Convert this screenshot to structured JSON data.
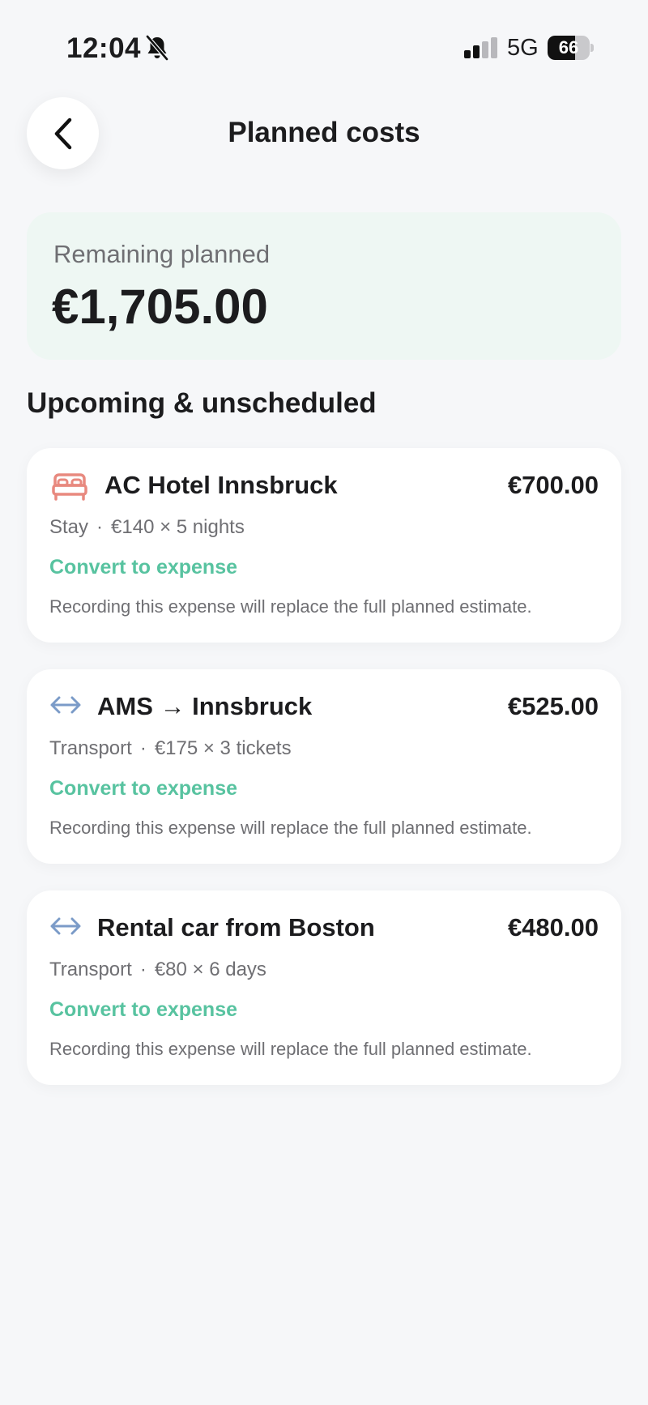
{
  "status_bar": {
    "time": "12:04",
    "network": "5G",
    "battery": "66",
    "battery_level": 0.66
  },
  "header": {
    "title": "Planned costs"
  },
  "summary": {
    "label": "Remaining planned",
    "amount": "€1,705.00",
    "background_color": "#eef7f3"
  },
  "section": {
    "title": "Upcoming & unscheduled"
  },
  "accent_color": "#58c3a0",
  "cards": [
    {
      "icon": "bed-icon",
      "icon_color": "#e8897f",
      "name": "AC Hotel Innsbruck",
      "amount": "€700.00",
      "category": "Stay",
      "detail": "€140 × 5 nights",
      "action": "Convert to expense",
      "note": "Recording this expense will replace the full planned estimate."
    },
    {
      "icon": "transport-arrows-icon",
      "icon_color": "#7b9bc8",
      "name": "AMS → Innsbruck",
      "amount": "€525.00",
      "category": "Transport",
      "detail": "€175 × 3 tickets",
      "action": "Convert to expense",
      "note": "Recording this expense will replace the full planned estimate."
    },
    {
      "icon": "transport-arrows-icon",
      "icon_color": "#7b9bc8",
      "name": "Rental car from Boston",
      "amount": "€480.00",
      "category": "Transport",
      "detail": "€80 × 6 days",
      "action": "Convert to expense",
      "note": "Recording this expense will replace the full planned estimate."
    }
  ]
}
